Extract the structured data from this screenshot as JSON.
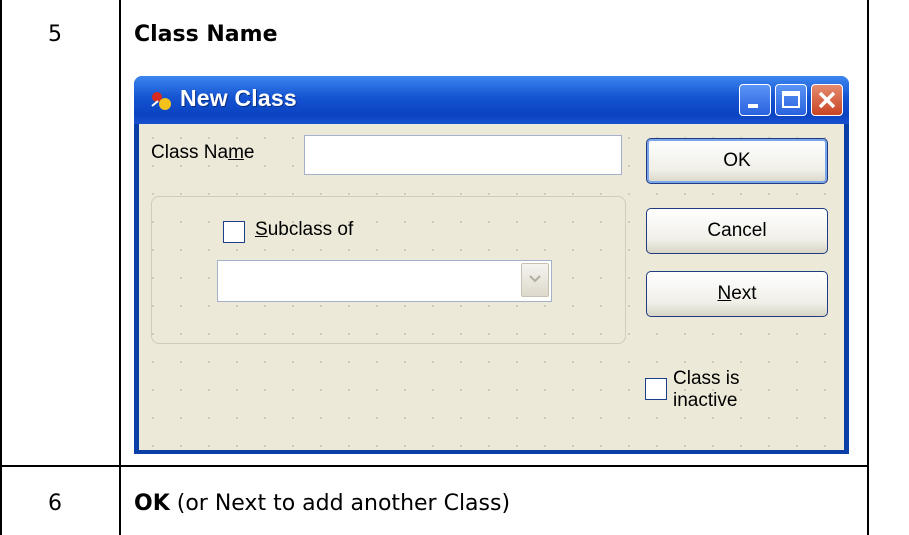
{
  "rows": [
    {
      "step": "5",
      "instruction_bold": "Class Name",
      "instruction_rest": ""
    },
    {
      "step": "6",
      "instruction_bold": "OK",
      "instruction_rest": " (or Next to add another Class)"
    }
  ],
  "dialog": {
    "title": "New Class",
    "title_icon": "class-icon",
    "class_name_label_pre": "Class Na",
    "class_name_label_accel": "m",
    "class_name_label_post": "e",
    "class_name_value": "",
    "subclass_label_accel": "S",
    "subclass_label_rest": "ubclass of",
    "subclass_checked": false,
    "subclass_select_value": "",
    "ok_label": "OK",
    "cancel_label": "Cancel",
    "next_label_accel": "N",
    "next_label_rest": "ext",
    "inactive_label_line1": "Class is",
    "inactive_label_line2": "inactive",
    "inactive_checked": false,
    "colors": {
      "titlebar": "#0a43c2",
      "client": "#ece9d8",
      "close_button": "#c94424"
    }
  }
}
